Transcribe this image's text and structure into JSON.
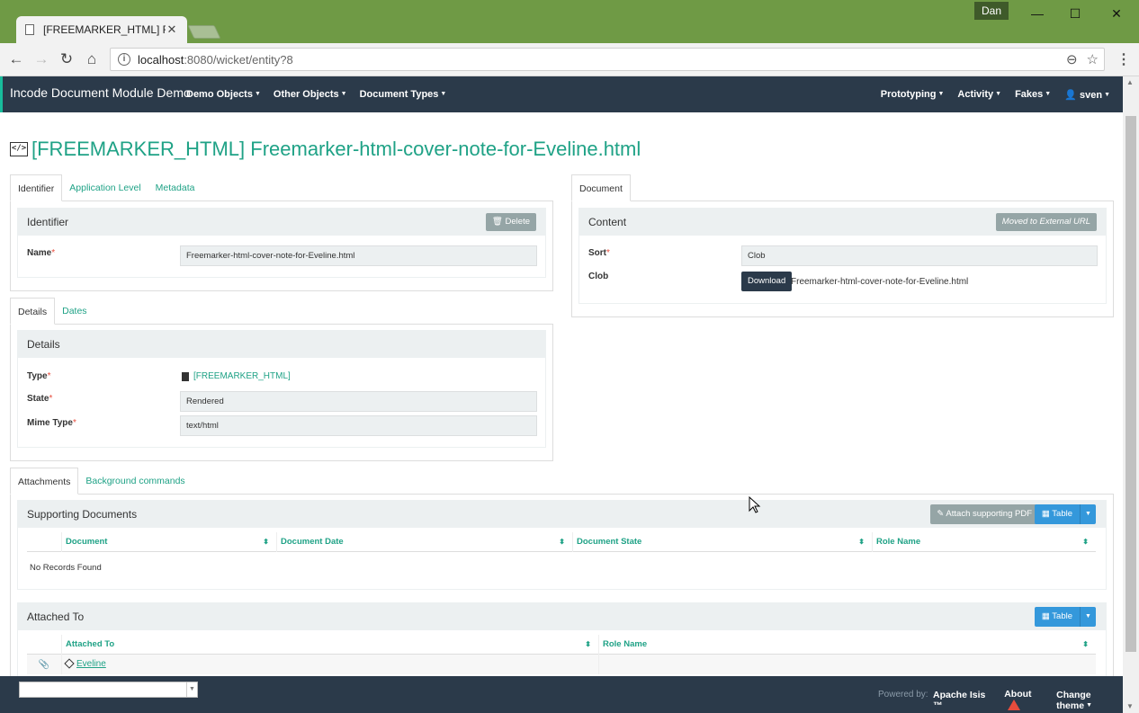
{
  "browser": {
    "tab_title": "[FREEMARKER_HTML] Fre",
    "user": "Dan",
    "url_host": "localhost",
    "url_path": ":8080/wicket/entity?8"
  },
  "navbar": {
    "brand": "Incode Document Module Demo",
    "left_menus": [
      "Demo Objects",
      "Other Objects",
      "Document Types"
    ],
    "right_menus": [
      "Prototyping",
      "Activity",
      "Fakes"
    ],
    "user": "sven"
  },
  "page": {
    "title": "[FREEMARKER_HTML] Freemarker-html-cover-note-for-Eveline.html",
    "identifier_tabs": [
      "Identifier",
      "Application Level",
      "Metadata"
    ],
    "identifier_panel": {
      "heading": "Identifier",
      "delete_label": "Delete",
      "name_label": "Name",
      "name_value": "Freemarker-html-cover-note-for-Eveline.html"
    },
    "details_tabs": [
      "Details",
      "Dates"
    ],
    "details_panel": {
      "heading": "Details",
      "type_label": "Type",
      "type_value": "[FREEMARKER_HTML]",
      "state_label": "State",
      "state_value": "Rendered",
      "mime_label": "Mime Type",
      "mime_value": "text/html"
    },
    "document_tabs": [
      "Document"
    ],
    "content_panel": {
      "heading": "Content",
      "moved_label": "Moved to External URL",
      "sort_label": "Sort",
      "sort_value": "Clob",
      "clob_label": "Clob",
      "download_label": "Download",
      "clob_file": "Freemarker-html-cover-note-for-Eveline.html"
    },
    "attach_tabs": [
      "Attachments",
      "Background commands"
    ],
    "supporting_docs": {
      "heading": "Supporting Documents",
      "attach_label": "Attach supporting PDF",
      "table_label": "Table",
      "columns": [
        "Document",
        "Document Date",
        "Document State",
        "Role Name"
      ],
      "empty_text": "No Records Found"
    },
    "attached_to": {
      "heading": "Attached To",
      "table_label": "Table",
      "columns": [
        "Attached To",
        "Role Name"
      ],
      "rows": [
        {
          "attached_to": "Eveline",
          "role_name": ""
        }
      ]
    }
  },
  "footer": {
    "powered_by": "Powered by:",
    "apache": "Apache Isis ™",
    "about": "About",
    "change_theme": "Change theme"
  },
  "colors": {
    "navbar": "#2b3a4a",
    "accent": "#18bc9c",
    "link": "#1fa286",
    "table_button": "#3498db"
  }
}
